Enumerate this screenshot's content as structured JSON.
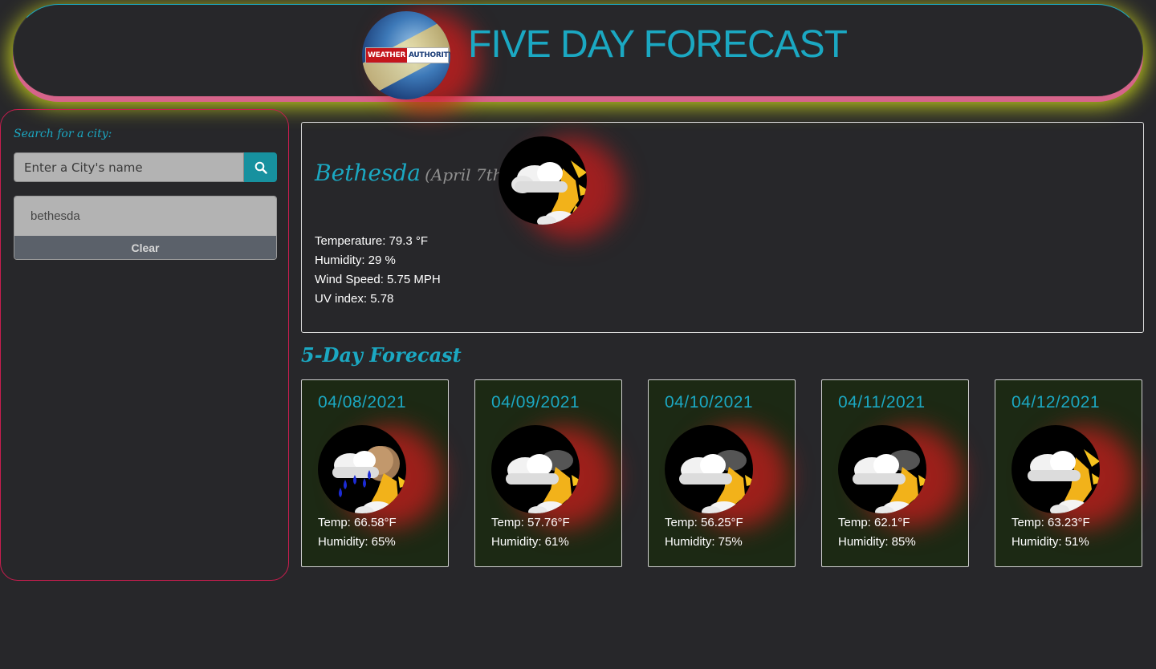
{
  "header": {
    "title": "FIVE DAY FORECAST",
    "logo_text": {
      "part1": "WEATHER",
      "part2": "AUTHORITY"
    }
  },
  "sidebar": {
    "search_label": "Search for a city:",
    "search_placeholder": "Enter a City's name",
    "search_value": "",
    "search_button_icon": "search-icon",
    "history": [
      {
        "label": "bethesda"
      }
    ],
    "clear_label": "Clear"
  },
  "current": {
    "city": "Bethesda",
    "date": "(April 7th)",
    "icon": "partly-cloudy-icon",
    "temperature": "Temperature: 79.3 °F",
    "humidity": "Humidity: 29 %",
    "wind": "Wind Speed: 5.75 MPH",
    "uv": "UV index: 5.78"
  },
  "forecast": {
    "heading": "5-Day Forecast",
    "days": [
      {
        "date": "04/08/2021",
        "icon": "rain-icon",
        "temp": "Temp: 66.58°F",
        "humidity": "Humidity: 65%"
      },
      {
        "date": "04/09/2021",
        "icon": "partly-cloudy-icon",
        "temp": "Temp: 57.76°F",
        "humidity": "Humidity: 61%"
      },
      {
        "date": "04/10/2021",
        "icon": "partly-cloudy-icon",
        "temp": "Temp: 56.25°F",
        "humidity": "Humidity: 75%"
      },
      {
        "date": "04/11/2021",
        "icon": "partly-cloudy-icon",
        "temp": "Temp: 62.1°F",
        "humidity": "Humidity: 85%"
      },
      {
        "date": "04/12/2021",
        "icon": "partly-cloudy-icon",
        "temp": "Temp: 63.23°F",
        "humidity": "Humidity: 51%"
      }
    ]
  },
  "colors": {
    "accent": "#1ba8c2",
    "background": "#27272a",
    "card_background": "#1c2914",
    "sidebar_border": "#c81d4e",
    "header_underline": "#d6648a",
    "header_glow": "#c8d21c"
  }
}
